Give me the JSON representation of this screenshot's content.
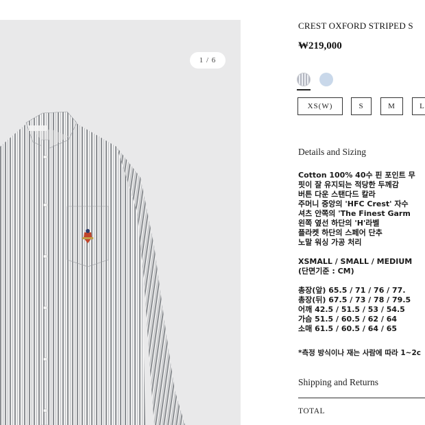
{
  "gallery": {
    "counter": "1 / 6"
  },
  "product": {
    "title": "CREST OXFORD STRIPED S",
    "price": "₩219,000"
  },
  "colors": {
    "selected": "#b3b6c0",
    "alternate": "#c9d8ea"
  },
  "sizes": [
    "XS(W)",
    "S",
    "M",
    "L"
  ],
  "details": {
    "heading": "Details and Sizing",
    "lines": [
      "Cotton 100% 40수 핀 포인트 무",
      "핏이 잘 유지되는 적당한 두께감",
      "버튼 다운 스탠다드 칼라",
      "주머니 중앙의 'HFC Crest' 자수",
      "셔츠 안쪽의 'The Finest Garm",
      "왼쪽 옆선 하단의 'H'라벨",
      "플라켓 하단의 스페어 단추",
      "노말 워싱 가공 처리"
    ],
    "size_header": [
      "XSMALL / SMALL / MEDIUM",
      "(단면기준 : CM)"
    ],
    "measurements": [
      "총장(앞) 65.5 / 71 / 76  / 77.",
      "총장(뒤) 67.5 / 73 / 78 / 79.5",
      "어깨 42.5 / 51.5 / 53 / 54.5",
      "가슴 51.5 / 60.5 / 62 / 64",
      "소매 61.5 / 60.5 / 64 / 65"
    ],
    "note": "*측정 방식이나 재는 사람에 따라 1~2c"
  },
  "shipping": {
    "heading": "Shipping and Returns"
  },
  "total": {
    "label": "TOTAL"
  }
}
